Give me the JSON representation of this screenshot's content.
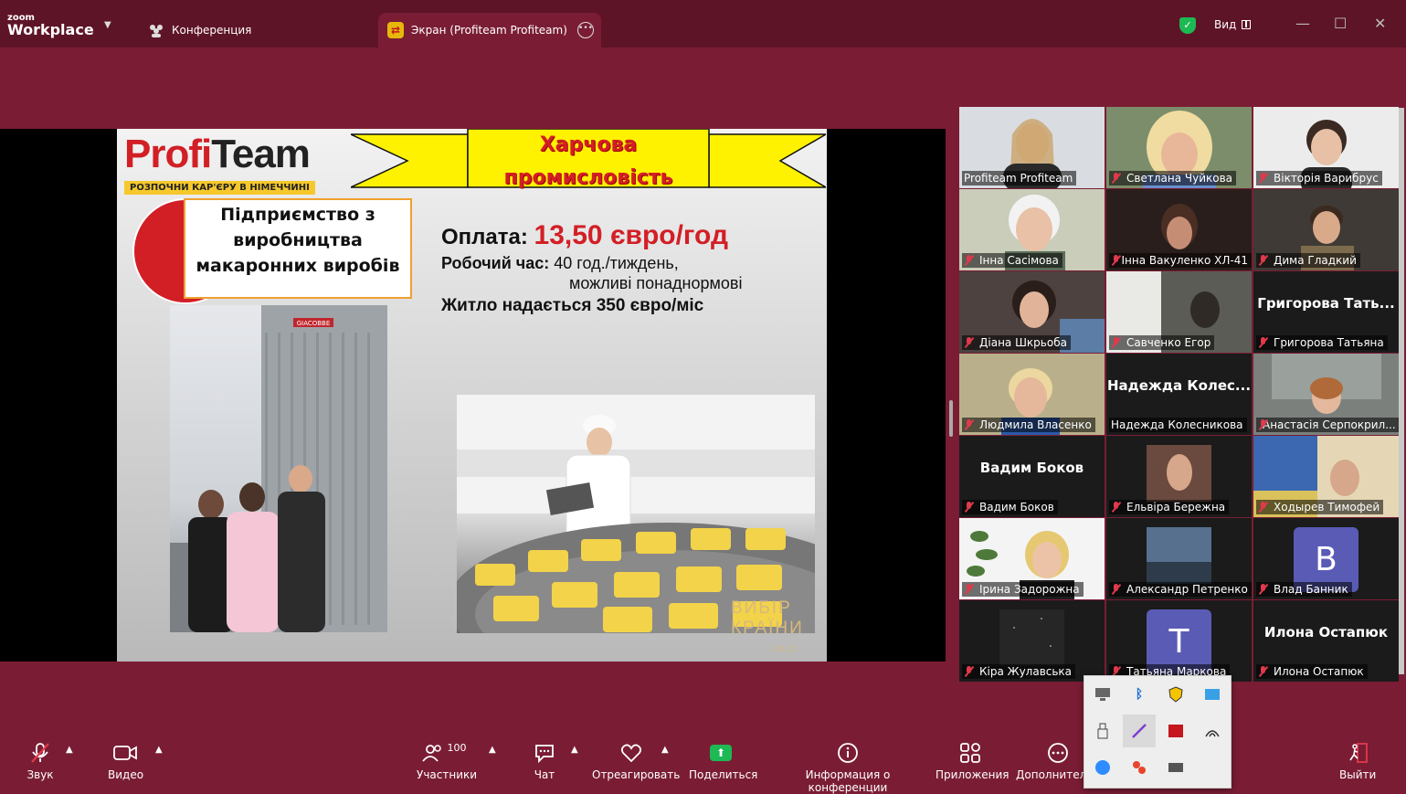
{
  "titlebar": {
    "brand_top": "zoom",
    "brand_bottom": "Workplace",
    "tab_conference": "Конференция",
    "tab_screen": "Экран (Profiteam Profiteam)",
    "view_label": "Вид"
  },
  "slide": {
    "logo_profi": "Profi",
    "logo_team": "Team",
    "logo_sub": "РОЗПОЧНИ КАР'ЄРУ В НІМЕЧЧИНІ",
    "banner_title": "Харчова промисловість",
    "company": "Підприємство з виробництва макаронних виробів",
    "pay_label": "Оплата:",
    "pay_value": "13,50 євро/год",
    "hours_label": "Робочий час:",
    "hours_line1": "40 год./тиждень,",
    "hours_line2": "можливі понаднормові",
    "housing": "Житло надається 350 євро/міс",
    "sign_text": "GIACOBBE",
    "vybir_line1": "ВИБІР",
    "vybir_line2": "КРАЇНИ",
    "vybir_year": "2021"
  },
  "participants": [
    {
      "name": "Profiteam Profiteam",
      "muted": false,
      "type": "video"
    },
    {
      "name": "Светлана Чуйкова",
      "muted": true,
      "type": "video"
    },
    {
      "name": "Вікторія Варибрус",
      "muted": true,
      "type": "video"
    },
    {
      "name": "Інна Сасімова",
      "muted": true,
      "type": "video"
    },
    {
      "name": "Інна Вакуленко ХЛ-41",
      "muted": true,
      "type": "video"
    },
    {
      "name": "Дима Гладкий",
      "muted": true,
      "type": "video"
    },
    {
      "name": "Діана Шкрьоба",
      "muted": true,
      "type": "video"
    },
    {
      "name": "Савченко Егор",
      "muted": true,
      "type": "video"
    },
    {
      "name": "Григорова Татьяна",
      "muted": true,
      "type": "text",
      "big": "Григорова Тать..."
    },
    {
      "name": "Людмила Власенко",
      "muted": true,
      "type": "video"
    },
    {
      "name": "Надежда Колесникова",
      "muted": false,
      "type": "text",
      "big": "Надежда Колес..."
    },
    {
      "name": "Анастасія Серпокрил...",
      "muted": true,
      "type": "video"
    },
    {
      "name": "Вадим Боков",
      "muted": true,
      "type": "text",
      "big": "Вадим Боков"
    },
    {
      "name": "Ельвіра Бережна",
      "muted": true,
      "type": "video"
    },
    {
      "name": "Ходырев Тимофей",
      "muted": true,
      "type": "video"
    },
    {
      "name": "Ірина Задорожна",
      "muted": true,
      "type": "video"
    },
    {
      "name": "Александр Петренко",
      "muted": true,
      "type": "video"
    },
    {
      "name": "Влад Банник",
      "muted": true,
      "type": "avatar",
      "letter": "B"
    },
    {
      "name": "Кіра Жулавська",
      "muted": true,
      "type": "video"
    },
    {
      "name": "Татьяна Маркова",
      "muted": true,
      "type": "avatar",
      "letter": "T"
    },
    {
      "name": "Илона Остапюк",
      "muted": true,
      "type": "text",
      "big": "Илона Остапюк"
    }
  ],
  "toolbar": {
    "audio": "Звук",
    "video": "Видео",
    "participants": "Участники",
    "participants_count": "100",
    "chat": "Чат",
    "react": "Отреагировать",
    "share": "Поделиться",
    "info": "Информация о конференции",
    "apps": "Приложения",
    "more": "Дополнитель",
    "leave": "Выйти"
  },
  "tray_icons": [
    "monitor-icon",
    "bluetooth-icon",
    "shield-icon",
    "network-icon",
    "usb-icon",
    "pen-icon",
    "media-icon",
    "wifi-icon",
    "zoom-icon",
    "app-icon",
    "display-icon"
  ],
  "colors": {
    "accent_green": "#23d18b",
    "muted_red": "#e1394b",
    "bg": "#7a1d34",
    "slide_red": "#d21f26"
  }
}
